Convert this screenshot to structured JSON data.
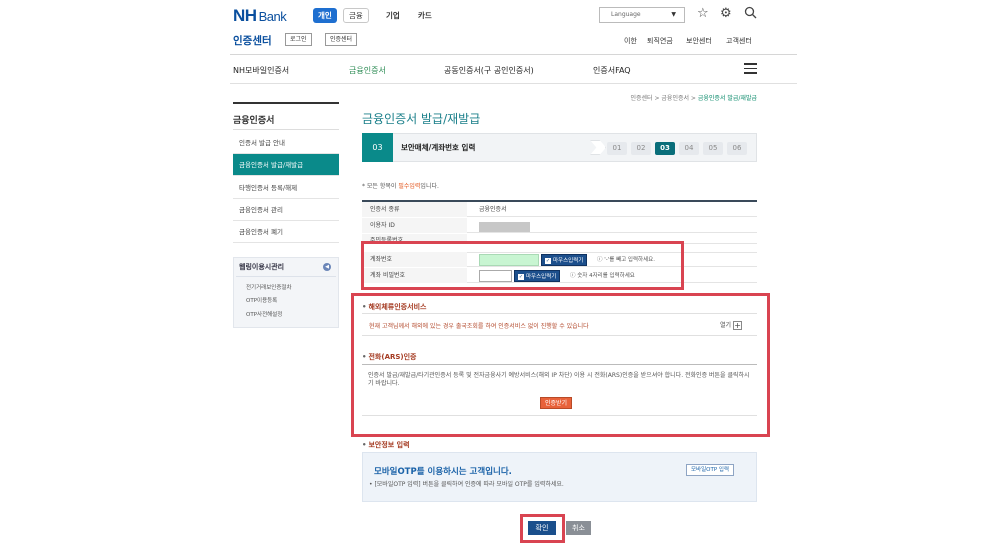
{
  "header": {
    "logo": "NH",
    "logo_sub": "Bank",
    "segments": [
      "개인",
      "금융",
      "기업",
      "카드"
    ],
    "language": "Language",
    "cert_center": "인증센터",
    "login_btn": "로그인",
    "cert_btn": "인증센터",
    "util_links": [
      "이한",
      "퇴직연금",
      "보안센터",
      "고객센터"
    ],
    "gnb": [
      "NH모바일인증서",
      "금융인증서",
      "공동인증서(구 공인인증서)",
      "인증서FAQ"
    ]
  },
  "breadcrumb": {
    "path": "인증센터 > 금융인증서 > ",
    "current": "금융인증서 발급/재발급"
  },
  "sidebar": {
    "title": "금융인증서",
    "items": [
      "인증서 발급 안내",
      "금융인증서 발급/재발급",
      "타행인증서 등록/해제",
      "금융인증서 관리",
      "금융인증서 폐기"
    ],
    "box_title": "웹링이용시관리",
    "box_links": [
      "전기거래보인증절차",
      "OTP이용등록",
      "OTP사전해설정"
    ]
  },
  "main": {
    "title": "금융인증서 발급/재발급",
    "step_current": "03",
    "step_name": "보안매체/계좌번호 입력",
    "steps": [
      "01",
      "02",
      "03",
      "04",
      "05",
      "06"
    ],
    "required_note_pre": "* 모든 항목이 ",
    "required_note_req": "필수입력",
    "required_note_post": "입니다.",
    "rows": [
      {
        "label": "인증서 종류",
        "value": "금융인증서"
      },
      {
        "label": "이용자 ID",
        "value": ""
      },
      {
        "label": "주민등록번호",
        "value": ""
      },
      {
        "label": "계좌번호",
        "value": ""
      },
      {
        "label": "계좌 비밀번호",
        "value": ""
      }
    ],
    "mouse_input": "마우스입력기",
    "hint_account": "'-'를 빼고 입력하세요.",
    "hint_password": "숫자 4자리를 입력하세요",
    "foreign_title": "해외체류인증서비스",
    "foreign_text": "현재 고객님께서 해외에 있는 경우 출국조회를 하여 인증서비스 없이 진행할 수 있습니다",
    "fold_label": "열기",
    "ars_title": "전화(ARS)인증",
    "ars_desc": "인증서 발급/재발급/타기관인증서 등록 및 전자금융사기 예방서비스(해외 IP 차단) 이용 시 전화(ARS)인증을 받으셔야 합니다. 전화인증 버튼을 클릭하시기 바랍니다.",
    "ars_btn": "인증받기",
    "otp_section": "보안정보 입력",
    "otp_title": "모바일OTP를 이용하시는 고객입니다.",
    "otp_desc": "• [모바일OTP 입력] 버튼을 클릭하여 인증에 따라 모바일 OTP를 입력하세요.",
    "otp_btn": "모바일OTP 입력",
    "ok": "확인",
    "cancel": "취소"
  },
  "colors": {
    "accent": "#0a8a8a",
    "brand": "#0a4f9e",
    "highlight_box": "#d94451"
  }
}
